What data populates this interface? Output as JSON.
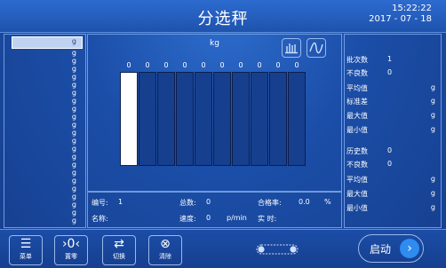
{
  "header": {
    "title": "分选秤",
    "time": "15:22:22",
    "date": "2017 - 07 - 18"
  },
  "left_panel": {
    "selected_unit": "g",
    "rows": [
      "g",
      "g",
      "g",
      "g",
      "g",
      "g",
      "g",
      "g",
      "g",
      "g",
      "g",
      "g",
      "g",
      "g",
      "g",
      "g",
      "g",
      "g",
      "g",
      "g",
      "g",
      "g"
    ]
  },
  "center": {
    "unit": "kg",
    "counts": [
      "0",
      "0",
      "0",
      "0",
      "0",
      "0",
      "0",
      "0",
      "0",
      "0"
    ],
    "bars_levels": [
      1,
      0,
      0,
      0,
      0,
      0,
      0,
      0,
      0,
      0
    ]
  },
  "info": {
    "number_label": "编号:",
    "number_value": "1",
    "total_label": "总数:",
    "total_value": "0",
    "pass_rate_label": "合格率:",
    "pass_rate_value": "0.0",
    "pass_rate_unit": "%",
    "name_label": "名称:",
    "speed_label": "速度:",
    "speed_value": "0",
    "speed_unit": "p/min",
    "realtime_label": "实 时:"
  },
  "right_panel": {
    "batch_count_label": "批次数",
    "batch_count_value": "1",
    "bad_count_label": "不良数",
    "bad_count_value": "0",
    "avg_label": "平均值",
    "avg_unit": "g",
    "std_label": "标准差",
    "std_unit": "g",
    "max_label": "最大值",
    "max_unit": "g",
    "min_label": "最小值",
    "min_unit": "g",
    "history_label": "历史数",
    "history_value": "0",
    "hist_bad_label": "不良数",
    "hist_bad_value": "0",
    "hist_avg_label": "平均值",
    "hist_avg_unit": "g",
    "hist_max_label": "最大值",
    "hist_max_unit": "g",
    "hist_min_label": "最小值",
    "hist_min_unit": "g"
  },
  "toolbar": {
    "menu_label": "菜单",
    "zero_label": "置零",
    "switch_label": "切换",
    "clear_label": "清除",
    "start_label": "启动"
  }
}
